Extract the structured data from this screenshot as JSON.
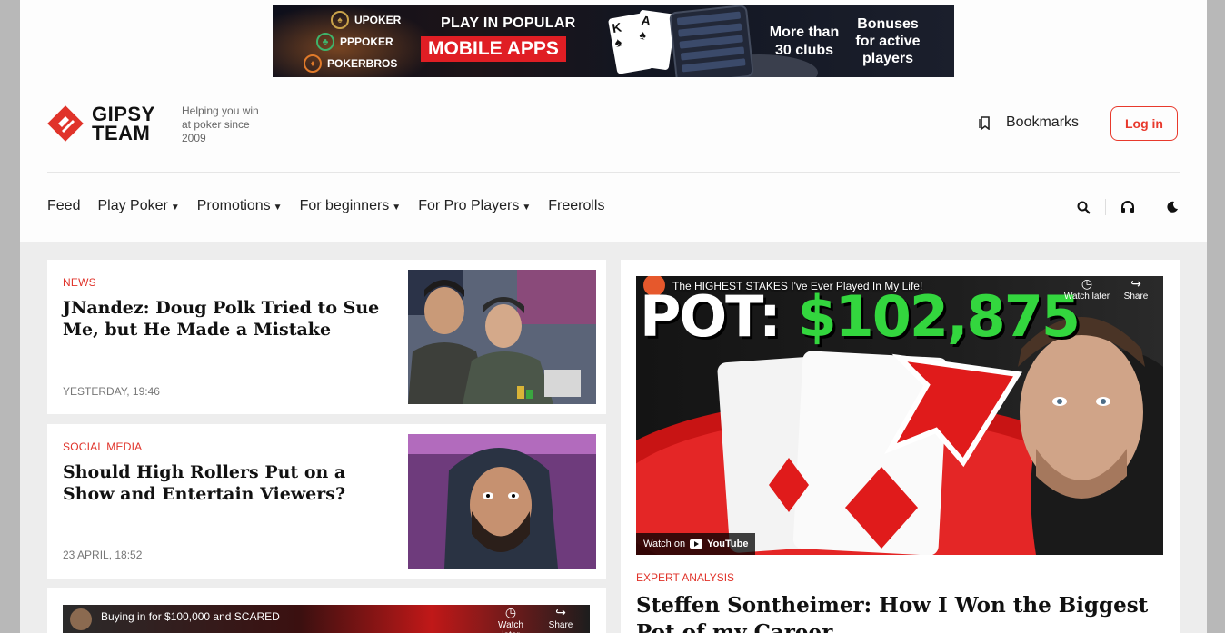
{
  "banner": {
    "apps": [
      "UPOKER",
      "PPPOKER",
      "POKERBROS"
    ],
    "play_text": "PLAY IN POPULAR",
    "mobile_text": "MOBILE APPS",
    "clubs_text": "More than 30 clubs",
    "bonus_text": "Bonuses for active players"
  },
  "header": {
    "logo_line1": "GIPSY",
    "logo_line2": "TEAM",
    "tagline": "Helping you win at poker since 2009",
    "bookmarks_label": "Bookmarks",
    "login_label": "Log in"
  },
  "nav": {
    "items": [
      {
        "label": "Feed",
        "dropdown": false
      },
      {
        "label": "Play Poker",
        "dropdown": true
      },
      {
        "label": "Promotions",
        "dropdown": true
      },
      {
        "label": "For beginners",
        "dropdown": true
      },
      {
        "label": "For Pro Players",
        "dropdown": true
      },
      {
        "label": "Freerolls",
        "dropdown": false
      }
    ],
    "tools": [
      "search-icon",
      "headset-icon",
      "moon-icon"
    ]
  },
  "articles": [
    {
      "category": "NEWS",
      "title": "JNandez: Doug Polk Tried to Sue Me, but He Made a Mistake",
      "date": "YESTERDAY, 19:46"
    },
    {
      "category": "SOCIAL MEDIA",
      "title": "Should High Rollers Put on a Show and Entertain Viewers?",
      "date": "23 APRIL, 18:52"
    },
    {
      "video_title": "Buying in for $100,000 and SCARED",
      "watch_later": "Watch later",
      "share": "Share"
    }
  ],
  "feature": {
    "video_title": "The HIGHEST STAKES I've Ever Played In My Life!",
    "pot_prefix": "POT:",
    "pot_amount": "$102,875",
    "watch_later": "Watch later",
    "share": "Share",
    "watch_on": "Watch on",
    "youtube": "YouTube",
    "category": "EXPERT ANALYSIS",
    "title": "Steffen Sontheimer: How I Won the Biggest Pot of my Career"
  },
  "colors": {
    "accent": "#e0332a",
    "pot_green": "#33d63e"
  }
}
